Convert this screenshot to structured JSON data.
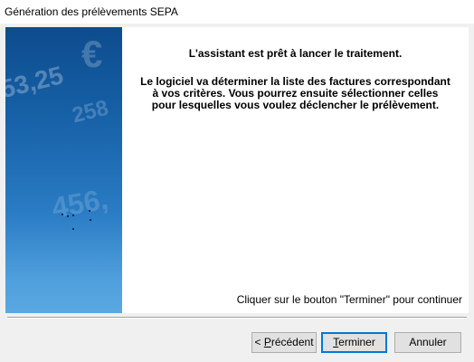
{
  "window": {
    "title": "Génération des prélèvements SEPA"
  },
  "banner": {
    "numbers": [
      "53,25",
      "€",
      "258",
      "456,"
    ]
  },
  "content": {
    "heading": "L'assistant est prêt à lancer le traitement.",
    "description_lines": [
      "Le logiciel va déterminer la liste des factures correspondant",
      "à vos critères. Vous pourrez ensuite sélectionner celles",
      "pour lesquelles vous voulez déclencher le prélèvement."
    ],
    "hint": "Cliquer sur le bouton \"Terminer\" pour continuer"
  },
  "buttons": {
    "previous": {
      "prefix": "< ",
      "mnemonic": "P",
      "rest": "récédent"
    },
    "finish": {
      "mnemonic": "T",
      "rest": "erminer"
    },
    "cancel": {
      "label": "Annuler"
    }
  }
}
